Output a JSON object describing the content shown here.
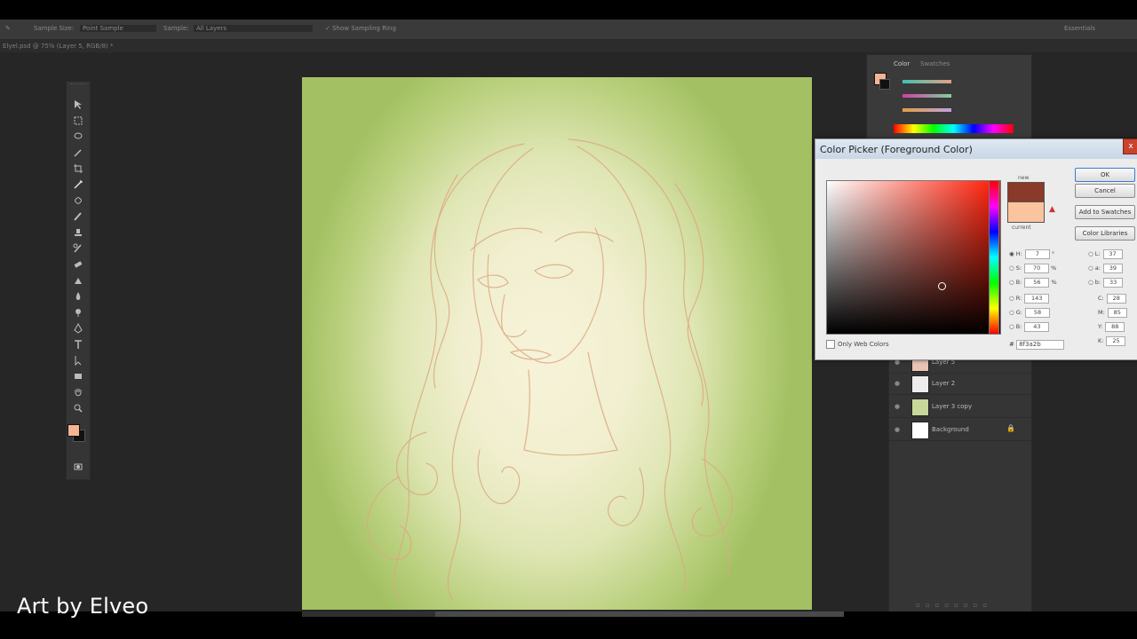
{
  "app": {
    "options_bar": {
      "sample_size_label": "Sample Size:",
      "sample_size_value": "Point Sample",
      "sample_label": "Sample:",
      "sample_value": "All Layers",
      "show_ring_label": "Show Sampling Ring",
      "workspace": "Essentials"
    },
    "document_tab": "Elyel.psd @ 75% (Layer 5, RGB/8) *"
  },
  "color_panel": {
    "tab_color": "Color",
    "tab_swatches": "Swatches",
    "foreground": "#f5b592"
  },
  "layers_panel": {
    "layers": [
      {
        "name": "Layer 5"
      },
      {
        "name": "Layer 2"
      },
      {
        "name": "Layer 3 copy"
      },
      {
        "name": "Background"
      }
    ]
  },
  "color_picker": {
    "title": "Color Picker (Foreground Color)",
    "close_glyph": "x",
    "new_label": "new",
    "current_label": "current",
    "ok_label": "OK",
    "cancel_label": "Cancel",
    "add_swatches_label": "Add to Swatches",
    "libraries_label": "Color Libraries",
    "hsb": [
      {
        "label": "H:",
        "value": "7",
        "unit": "°"
      },
      {
        "label": "S:",
        "value": "70",
        "unit": "%"
      },
      {
        "label": "B:",
        "value": "56",
        "unit": "%"
      }
    ],
    "rgb": [
      {
        "label": "R:",
        "value": "143"
      },
      {
        "label": "G:",
        "value": "58"
      },
      {
        "label": "B:",
        "value": "43"
      }
    ],
    "lab": [
      {
        "label": "L:",
        "value": "37"
      },
      {
        "label": "a:",
        "value": "39"
      },
      {
        "label": "b:",
        "value": "33"
      }
    ],
    "cmyk": [
      {
        "label": "C:",
        "value": "28"
      },
      {
        "label": "M:",
        "value": "85"
      },
      {
        "label": "Y:",
        "value": "88"
      },
      {
        "label": "K:",
        "value": "25"
      }
    ],
    "only_web_colors": "Only Web Colors",
    "hex_value": "8f3a2b",
    "new_color": "#8a3a28",
    "current_color": "#f9c49e"
  },
  "credit": "Art by Elveo"
}
